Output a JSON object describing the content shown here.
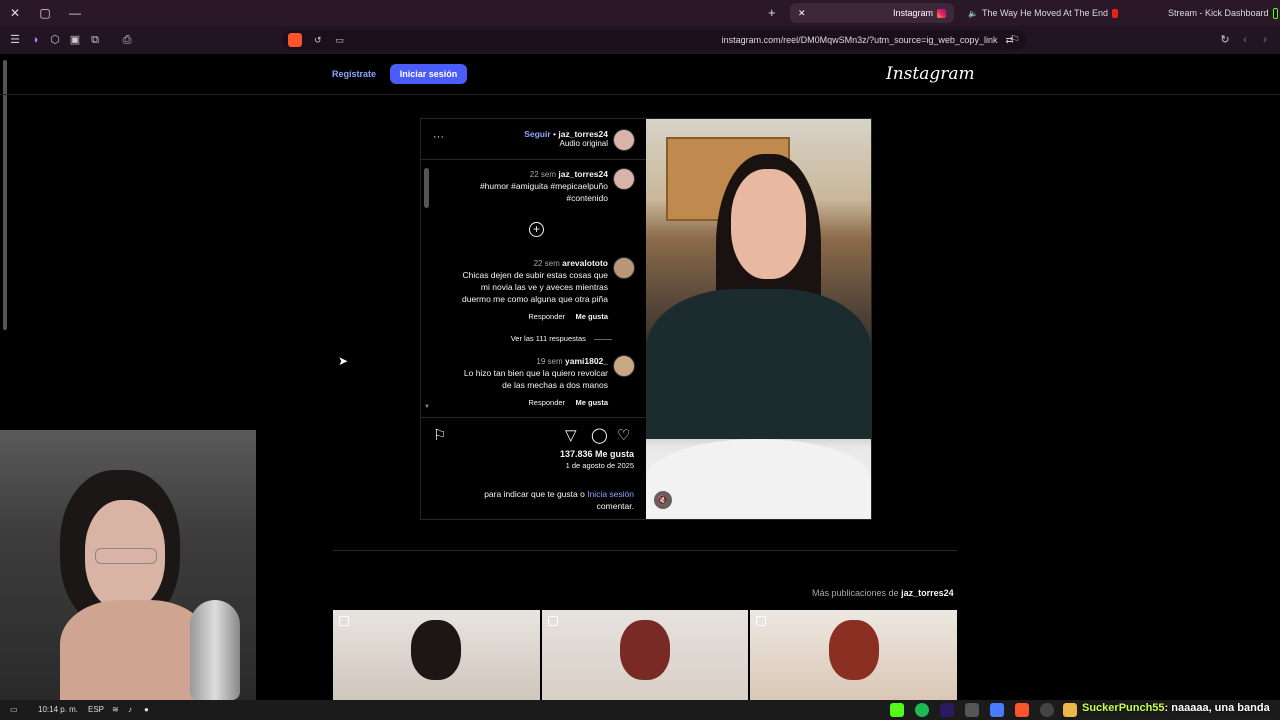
{
  "browser": {
    "tabs": [
      {
        "title": "Stream - Kick Dashboard",
        "active": false
      },
      {
        "title": "The Way He Moved At The End",
        "active": false
      },
      {
        "title": "Instagram",
        "active": true
      }
    ],
    "new_tab": "+",
    "url": "instagram.com/reel/DM0MqwSMn3z/?utm_source=ig_web_copy_link"
  },
  "instagram": {
    "logo": "Instagram",
    "login_button": "Iniciar sesión",
    "register_link": "Regístrate",
    "post": {
      "username": "jaz_torres24",
      "follow": "Seguir",
      "separator": "•",
      "audio": "Audio original",
      "more": "···",
      "caption": {
        "username": "jaz_torres24",
        "time": "22 sem",
        "hashtags_line1": "#humor #amiguita #mepicaelpuño",
        "hashtags_line2": "#contenido"
      },
      "comments": [
        {
          "username": "arevalototo",
          "time": "22 sem",
          "lines": [
            "Chicas dejen de subir estas cosas que",
            "mi novia las ve y aveces mientras",
            "duermo me como alguna que otra piña"
          ],
          "like": "Me gusta",
          "reply": "Responder",
          "view_replies": "Ver las 111 respuestas"
        },
        {
          "username": "yami1802_",
          "time": "19 sem",
          "lines": [
            "Lo hizo tan bien que la quiero revolcar",
            "de las mechas a dos manos"
          ],
          "like": "Me gusta",
          "reply": "Responder"
        }
      ],
      "likes": "137.836 Me gusta",
      "date": "1 de agosto de 2025",
      "login_prompt_link": "Inicia sesión",
      "login_prompt_rest": "para indicar que te gusta o",
      "login_prompt_end": "comentar."
    },
    "more_posts_prefix": "Más publicaciones de",
    "more_posts_user": "jaz_torres24"
  },
  "taskbar": {
    "time": "10:14 p. m.",
    "lang": "ESP",
    "chat_user": "SuckerPunch55",
    "chat_text": ": naaaaa, una banda"
  },
  "colors": {
    "accent": "#4a5df9",
    "link": "#8ea4ff",
    "tab_bg": "#2a1727"
  }
}
